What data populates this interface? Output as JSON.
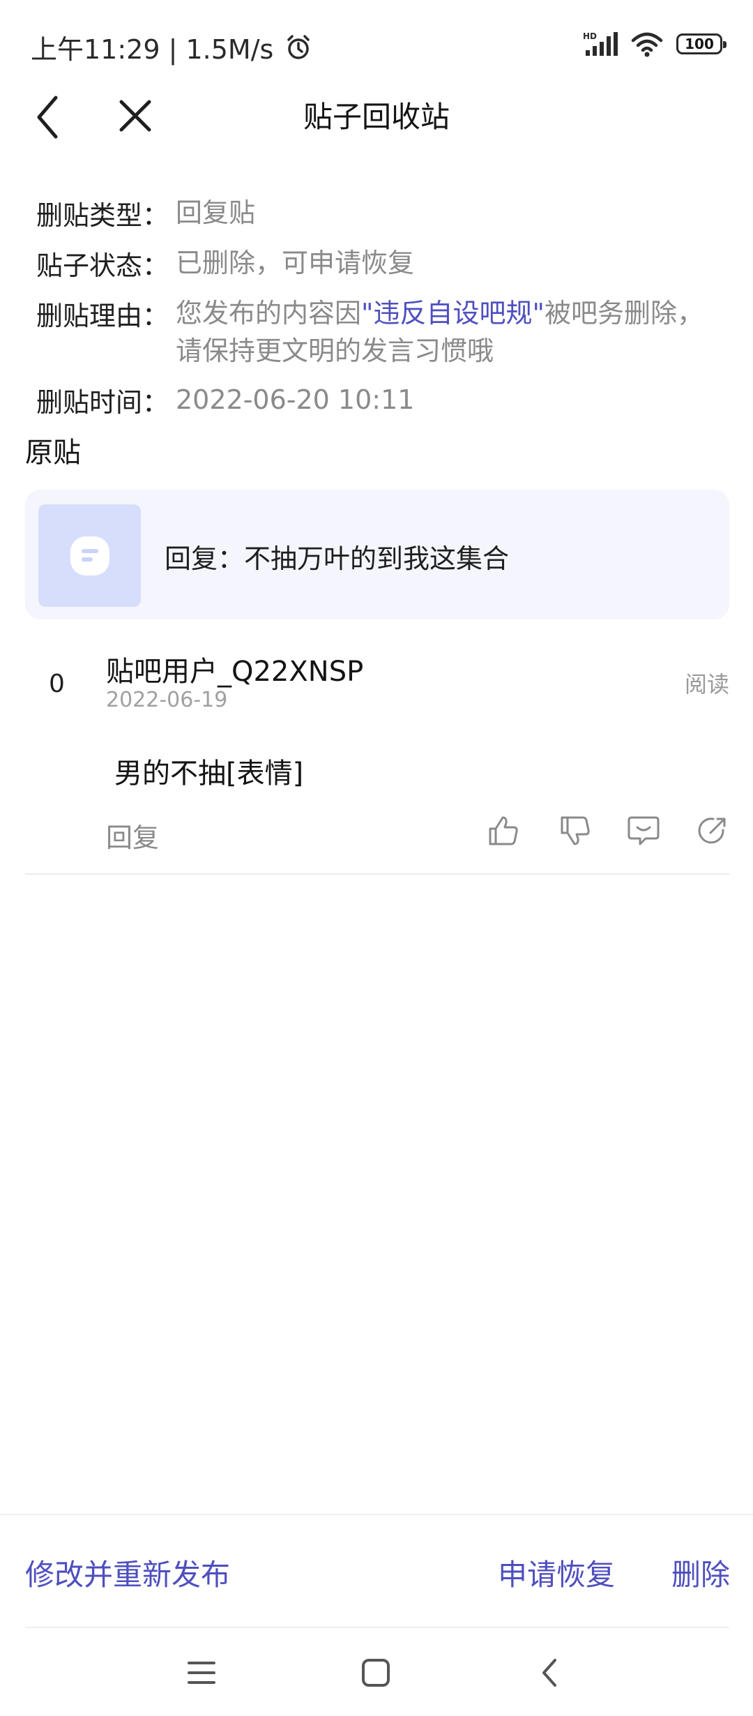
{
  "status_bar": {
    "time_speed": "上午11:29 | 1.5M/s",
    "battery": "100",
    "hd_label": "HD"
  },
  "nav": {
    "title": "贴子回收站"
  },
  "info": {
    "type_label": "删贴类型：",
    "type_value": "回复贴",
    "status_label": "贴子状态：",
    "status_value": "已删除，可申请恢复",
    "reason_label": "删贴理由：",
    "reason_prefix": "您发布的内容因",
    "reason_rule": "\"违反自设吧规\"",
    "reason_suffix": "被吧务删除，请保持更文明的发言习惯哦",
    "time_label": "删贴时间：",
    "time_value": "2022-06-20 10:11"
  },
  "original": {
    "section_label": "原贴",
    "card_text": "回复：不抽万叶的到我这集合"
  },
  "reply": {
    "floor": "0",
    "username": "贴吧用户_Q22XNSP",
    "date": "2022-06-19",
    "read_label": "阅读",
    "content": "男的不抽[表情]",
    "reply_label": "回复"
  },
  "bottom_bar": {
    "edit_repost": "修改并重新发布",
    "request_restore": "申请恢复",
    "delete": "删除"
  },
  "colors": {
    "accent": "#4e4fbf",
    "card_bg": "#f5f6fd",
    "thumb_bg": "#d7defb"
  }
}
